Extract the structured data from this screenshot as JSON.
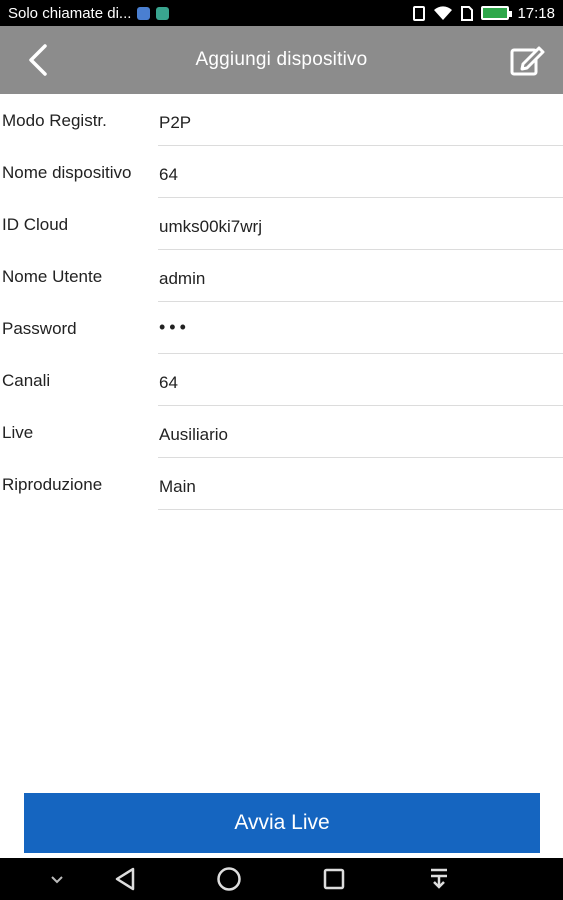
{
  "status_bar": {
    "notification_text": "Solo chiamate di...",
    "time": "17:18",
    "icons": [
      "app-notification-icon",
      "message-notification-icon",
      "vibrate-icon",
      "wifi-icon",
      "sim-icon",
      "battery-icon"
    ],
    "battery_color": "#2ea84a"
  },
  "header": {
    "title": "Aggiungi dispositivo",
    "background_color": "#8c8c8c",
    "back_icon": "chevron-left-icon",
    "edit_icon": "edit-icon"
  },
  "form": {
    "rows": [
      {
        "label": "Modo Registr.",
        "value": "P2P"
      },
      {
        "label": "Nome dispositivo",
        "value": "64"
      },
      {
        "label": "ID Cloud",
        "value": "umks00ki7wrj"
      },
      {
        "label": "Nome Utente",
        "value": "admin"
      },
      {
        "label": "Password",
        "value": "•••"
      },
      {
        "label": "Canali",
        "value": "64"
      },
      {
        "label": "Live",
        "value": "Ausiliario"
      },
      {
        "label": "Riproduzione",
        "value": "Main"
      }
    ]
  },
  "actions": {
    "start_live_label": "Avvia Live",
    "button_color": "#1565c0"
  },
  "nav_bar": {
    "icons": [
      "hide-keyboard-icon",
      "back-triangle-icon",
      "home-circle-icon",
      "recents-square-icon",
      "notification-pull-icon"
    ]
  }
}
